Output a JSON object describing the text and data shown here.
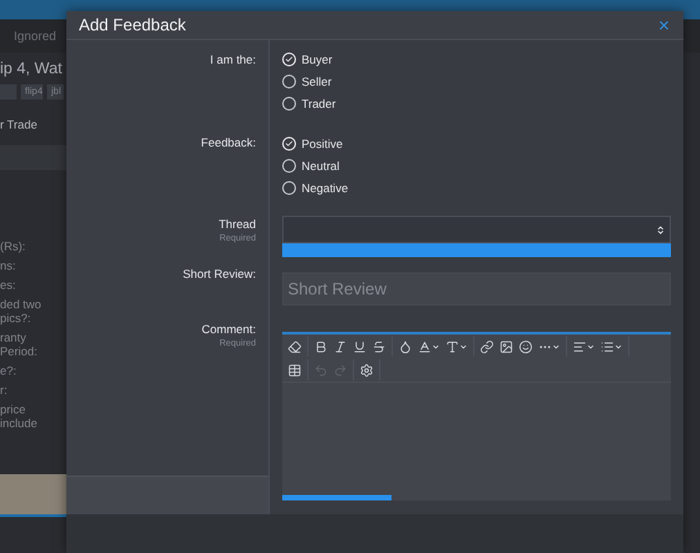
{
  "backdrop": {
    "filter_label": "Ignored",
    "thread_title": "ip 4, Wat",
    "tags": [
      "flip4",
      "jbl"
    ],
    "section": "r Trade",
    "fields": [
      "(Rs):",
      "ns:",
      "es:",
      "ded two pics?:",
      "ranty Period:",
      "e?:",
      "r:",
      "price include"
    ]
  },
  "modal": {
    "title": "Add Feedback",
    "close": "×",
    "role": {
      "label": "I am the:",
      "options": [
        {
          "label": "Buyer",
          "selected": true
        },
        {
          "label": "Seller",
          "selected": false
        },
        {
          "label": "Trader",
          "selected": false
        }
      ]
    },
    "feedback": {
      "label": "Feedback:",
      "options": [
        {
          "label": "Positive",
          "selected": true
        },
        {
          "label": "Neutral",
          "selected": false
        },
        {
          "label": "Negative",
          "selected": false
        }
      ]
    },
    "thread": {
      "label": "Thread",
      "note": "Required"
    },
    "short_review": {
      "label": "Short Review:",
      "placeholder": "Short Review"
    },
    "comment": {
      "label": "Comment:",
      "note": "Required",
      "level": 0.28,
      "toolbar": [
        [
          {
            "kind": "eraser",
            "disabled": false
          }
        ],
        [
          {
            "kind": "bold",
            "disabled": false
          },
          {
            "kind": "italic",
            "disabled": false
          },
          {
            "kind": "underline",
            "disabled": false
          },
          {
            "kind": "strike",
            "disabled": false
          }
        ],
        [
          {
            "kind": "color",
            "disabled": false
          },
          {
            "kind": "font",
            "disabled": false
          },
          {
            "kind": "size",
            "disabled": false
          }
        ],
        [
          {
            "kind": "link",
            "disabled": false
          },
          {
            "kind": "image",
            "disabled": false
          },
          {
            "kind": "smiley",
            "disabled": false
          },
          {
            "kind": "more",
            "disabled": false
          }
        ],
        [
          {
            "kind": "align",
            "disabled": false
          },
          {
            "kind": "list",
            "disabled": false
          }
        ]
      ],
      "toolbar_row2": [
        [
          {
            "kind": "table",
            "disabled": false
          }
        ],
        [
          {
            "kind": "undo",
            "disabled": true
          },
          {
            "kind": "redo",
            "disabled": true
          }
        ],
        [
          {
            "kind": "settings",
            "disabled": false
          }
        ]
      ]
    }
  }
}
